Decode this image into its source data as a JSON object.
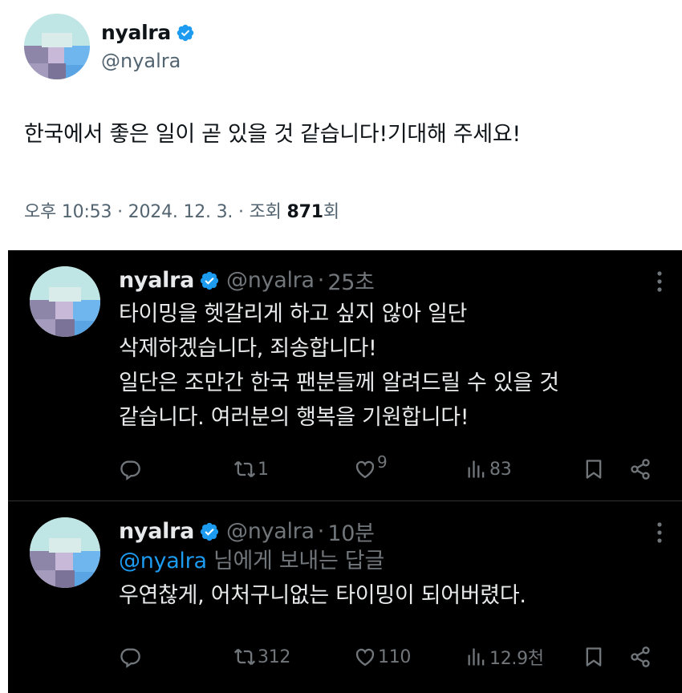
{
  "light_tweet": {
    "author_name": "nyalra",
    "author_handle": "@nyalra",
    "text": "한국에서 좋은 일이 곧 있을 것 같습니다!기대해 주세요!",
    "time": "오후 10:53",
    "sep1": "·",
    "date": "2024. 12. 3.",
    "sep2": "·",
    "views_label": "조회",
    "views_count": "871",
    "views_suffix": "회"
  },
  "tweets": [
    {
      "author_name": "nyalra",
      "author_handle": "@nyalra",
      "dot": "·",
      "time": "25초",
      "lines": [
        "타이밍을 헷갈리게 하고 싶지 않아 일단",
        "삭제하겠습니다, 죄송합니다!",
        "일단은 조만간 한국 팬분들께 알려드릴 수 있을 것",
        "같습니다. 여러분의 행복을 기원합니다!"
      ],
      "replies": "",
      "retweets": "1",
      "likes": "9",
      "views": "83"
    },
    {
      "author_name": "nyalra",
      "author_handle": "@nyalra",
      "dot": "·",
      "time": "10분",
      "reply_to_mention": "@nyalra",
      "reply_to_suffix": " 님에게 보내는 답글",
      "lines": [
        "우연찮게, 어처구니없는 타이밍이 되어버렸다."
      ],
      "replies": "",
      "retweets": "312",
      "likes": "110",
      "views": "12.9천"
    }
  ],
  "icons": {
    "verified": "verified-badge-icon",
    "more": "more-options-icon",
    "reply": "reply-icon",
    "retweet": "retweet-icon",
    "like": "like-icon",
    "views": "views-icon",
    "bookmark": "bookmark-icon",
    "share": "share-icon"
  },
  "colors": {
    "accent_blue": "#1d9bf0",
    "light_bg": "#ffffff",
    "dark_bg": "#000000",
    "muted_text": "#71767b",
    "avatar_mint": "#bfe8e6",
    "avatar_blue": "#6fb6ee",
    "avatar_purple": "#8a7fa6"
  }
}
